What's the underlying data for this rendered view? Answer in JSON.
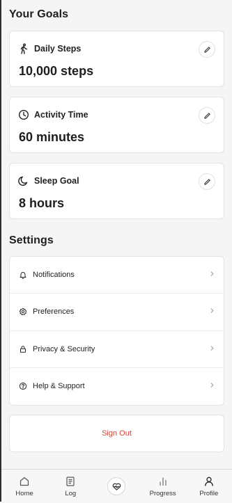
{
  "goals_section": {
    "title": "Your Goals"
  },
  "goals": [
    {
      "label": "Daily Steps",
      "value": "10,000 steps",
      "icon": "walking-icon"
    },
    {
      "label": "Activity Time",
      "value": "60 minutes",
      "icon": "clock-icon"
    },
    {
      "label": "Sleep Goal",
      "value": "8 hours",
      "icon": "moon-icon"
    }
  ],
  "settings_section": {
    "title": "Settings"
  },
  "settings": [
    {
      "label": "Notifications",
      "icon": "bell-icon"
    },
    {
      "label": "Preferences",
      "icon": "gear-icon"
    },
    {
      "label": "Privacy & Security",
      "icon": "lock-icon"
    },
    {
      "label": "Help & Support",
      "icon": "help-circle-icon"
    }
  ],
  "sign_out": {
    "label": "Sign Out",
    "color": "#d9433c"
  },
  "nav": [
    {
      "label": "Home",
      "icon": "home-icon"
    },
    {
      "label": "Log",
      "icon": "log-icon"
    },
    {
      "label": "",
      "icon": "heart-pulse-icon"
    },
    {
      "label": "Progress",
      "icon": "bar-chart-icon"
    },
    {
      "label": "Profile",
      "icon": "user-icon"
    }
  ]
}
